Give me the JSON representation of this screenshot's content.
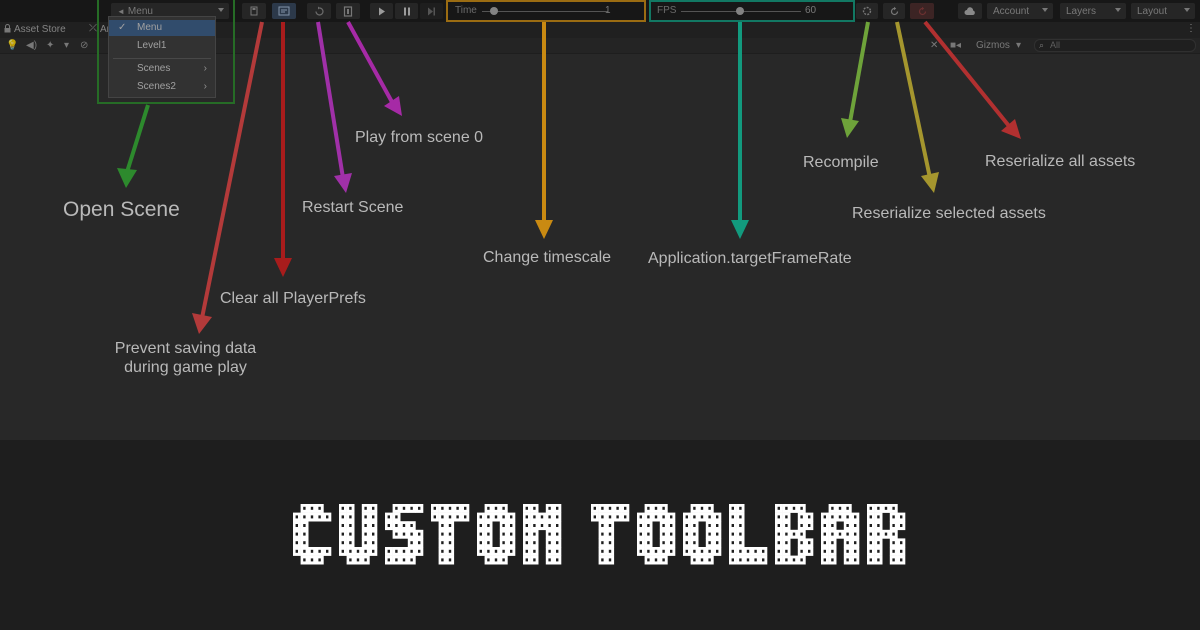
{
  "toolbar": {
    "scene_dropdown": "Menu",
    "time_slider": {
      "label": "Time",
      "value": "1",
      "level": 0.06
    },
    "fps_slider": {
      "label": "FPS",
      "value": "60",
      "level": 0.5
    },
    "account_label": "Account",
    "layers_label": "Layers",
    "layout_label": "Layout"
  },
  "tabs": {
    "asset_store": "Asset Store",
    "second_tab_partial": "An"
  },
  "scene_toolbar": {
    "gizmos_label": "Gizmos",
    "search_placeholder": "All"
  },
  "scene_menu": {
    "items": [
      {
        "label": "Menu",
        "checked": true
      },
      {
        "label": "Level1",
        "checked": false
      },
      {
        "label": "Scenes",
        "submenu": true
      },
      {
        "label": "Scenes2",
        "submenu": true
      }
    ],
    "submenu_glyph": "›"
  },
  "annotations": {
    "open_scene": "Open Scene",
    "prevent_saving_line1": "Prevent saving data",
    "prevent_saving_line2": "during game play",
    "clear_playerprefs": "Clear all PlayerPrefs",
    "restart_scene": "Restart Scene",
    "play_from_scene0": "Play from scene 0",
    "change_timescale": "Change timescale",
    "target_framerate": "Application.targetFrameRate",
    "recompile": "Recompile",
    "reserialize_selected": "Reserialize selected assets",
    "reserialize_all": "Reserialize all assets"
  },
  "banner": {
    "title": "CUSTOM TOOLBAR"
  },
  "colors": {
    "open_scene": "#2d8a2d",
    "prevent_saving": "#b33a3a",
    "clear_playerprefs": "#a81c1c",
    "restart_scene": "#a030a8",
    "play_from_scene0": "#a62aa6",
    "timescale": "#c98a12",
    "framerate": "#129a7e",
    "recompile": "#6ea33a",
    "reserialize_selected": "#a5962e",
    "reserialize_all": "#b23030"
  },
  "icons": [
    "unity-logo-icon",
    "lock-icon",
    "save-off-icon",
    "prefs-icon",
    "restart-icon",
    "scene0-icon",
    "play-icon",
    "pause-icon",
    "step-icon",
    "recompile-icon",
    "reserialize-selected-icon",
    "reserialize-all-icon",
    "cloud-icon",
    "audio-icon",
    "search-icon",
    "camera-icon",
    "tools-icon"
  ]
}
